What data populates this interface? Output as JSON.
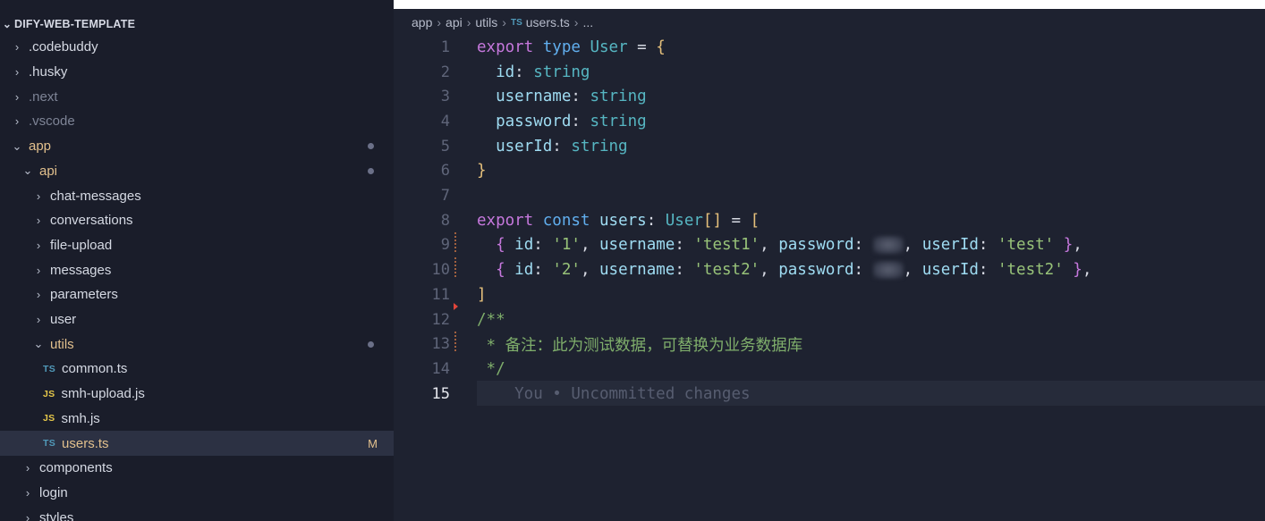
{
  "explorer": {
    "root": "DIFY-WEB-TEMPLATE",
    "items": [
      {
        "label": ".codebuddy",
        "kind": "folder",
        "depth": 0,
        "open": false
      },
      {
        "label": ".husky",
        "kind": "folder",
        "depth": 0,
        "open": false
      },
      {
        "label": ".next",
        "kind": "folder",
        "depth": 0,
        "open": false,
        "dim": true
      },
      {
        "label": ".vscode",
        "kind": "folder",
        "depth": 0,
        "open": false,
        "dim": true
      },
      {
        "label": "app",
        "kind": "folder",
        "depth": 0,
        "open": true,
        "modified": true
      },
      {
        "label": "api",
        "kind": "folder",
        "depth": 1,
        "open": true,
        "modified": true
      },
      {
        "label": "chat-messages",
        "kind": "folder",
        "depth": 2,
        "open": false
      },
      {
        "label": "conversations",
        "kind": "folder",
        "depth": 2,
        "open": false
      },
      {
        "label": "file-upload",
        "kind": "folder",
        "depth": 2,
        "open": false
      },
      {
        "label": "messages",
        "kind": "folder",
        "depth": 2,
        "open": false
      },
      {
        "label": "parameters",
        "kind": "folder",
        "depth": 2,
        "open": false
      },
      {
        "label": "user",
        "kind": "folder",
        "depth": 2,
        "open": false
      },
      {
        "label": "utils",
        "kind": "folder",
        "depth": 2,
        "open": true,
        "modified": true
      },
      {
        "label": "common.ts",
        "kind": "ts",
        "depth": 3,
        "icon": "TS"
      },
      {
        "label": "smh-upload.js",
        "kind": "js",
        "depth": 3,
        "icon": "JS"
      },
      {
        "label": "smh.js",
        "kind": "js",
        "depth": 3,
        "icon": "JS"
      },
      {
        "label": "users.ts",
        "kind": "ts",
        "depth": 3,
        "icon": "TS",
        "selected": true,
        "badge": "M"
      },
      {
        "label": "components",
        "kind": "folder",
        "depth": 1,
        "open": false
      },
      {
        "label": "login",
        "kind": "folder",
        "depth": 1,
        "open": false
      },
      {
        "label": "styles",
        "kind": "folder",
        "depth": 1,
        "open": false
      }
    ]
  },
  "breadcrumb": {
    "parts": [
      "app",
      "api",
      "utils"
    ],
    "file_icon": "TS",
    "file": "users.ts",
    "more": "..."
  },
  "code": {
    "line_numbers": [
      "1",
      "2",
      "3",
      "4",
      "5",
      "6",
      "7",
      "8",
      "9",
      "10",
      "11",
      "12",
      "13",
      "14",
      "15"
    ],
    "line1": {
      "kw": "export",
      "kw2": "type",
      "name": "User",
      "eq": "=",
      "open": "{"
    },
    "line2": {
      "prop": "id",
      "type": "string"
    },
    "line3": {
      "prop": "username",
      "type": "string"
    },
    "line4": {
      "prop": "password",
      "type": "string"
    },
    "line5": {
      "prop": "userId",
      "type": "string"
    },
    "line6": {
      "close": "}"
    },
    "line8": {
      "kw": "export",
      "kw2": "const",
      "name": "users",
      "type": "User",
      "arr": "[]",
      "eq": "=",
      "open": "["
    },
    "line9": {
      "id": "'1'",
      "username": "'test1'",
      "userId": "'test'"
    },
    "line10": {
      "id": "'2'",
      "username": "'test2'",
      "userId": "'test2'"
    },
    "keys": {
      "id": "id",
      "username": "username",
      "password": "password",
      "userId": "userId"
    },
    "line11": {
      "close": "]"
    },
    "line12": {
      "text": "/**"
    },
    "line13": {
      "text": " * 备注：此为测试数据，可替换为业务数据库"
    },
    "line14": {
      "text": " */"
    },
    "line15": {
      "ghost": "    You • Uncommitted changes"
    }
  }
}
